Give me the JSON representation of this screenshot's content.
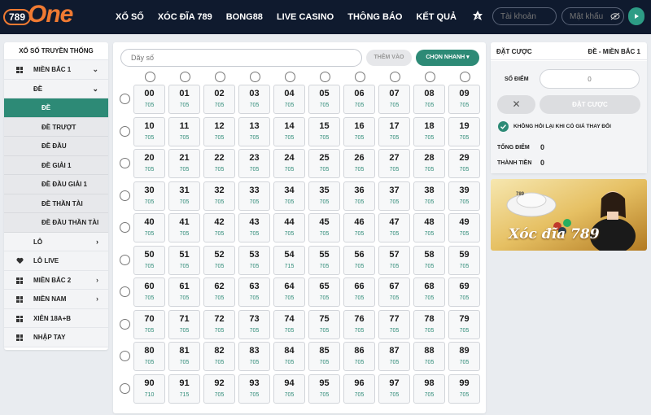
{
  "header": {
    "logo_prefix": "789",
    "logo_word": "One",
    "nav": [
      "XỔ SỐ",
      "XÓC ĐĨA 789",
      "BONG88",
      "LIVE CASINO",
      "THÔNG BÁO",
      "KẾT QUẢ"
    ],
    "account_placeholder": "Tài khoản",
    "password_placeholder": "Mật khẩu"
  },
  "sidebar": {
    "title": "XỔ SỐ TRUYỀN THỐNG",
    "mien_bac_1": "MIỀN BẮC 1",
    "de": "ĐỀ",
    "de_items": [
      "ĐỀ",
      "ĐỀ TRƯỢT",
      "ĐỀ ĐẦU",
      "ĐỀ GIẢI 1",
      "ĐỀ ĐẦU GIẢI 1",
      "ĐỀ THẦN TÀI",
      "ĐỀ ĐẦU THẦN TÀI"
    ],
    "lo": "LÔ",
    "lo_live": "LÔ LIVE",
    "mien_bac_2": "MIỀN BẮC 2",
    "mien_nam": "MIỀN NAM",
    "xien": "XIÊN 18A+B",
    "nhap_tay": "NHẬP TAY"
  },
  "main": {
    "input_placeholder": "Dãy số",
    "add_label": "THÊM VÀO",
    "quick_label": "CHỌN NHANH",
    "rates": [
      [
        "705",
        "705",
        "705",
        "705",
        "705",
        "705",
        "705",
        "705",
        "705",
        "705"
      ],
      [
        "705",
        "705",
        "705",
        "705",
        "705",
        "705",
        "705",
        "705",
        "705",
        "705"
      ],
      [
        "705",
        "705",
        "705",
        "705",
        "705",
        "705",
        "705",
        "705",
        "705",
        "705"
      ],
      [
        "705",
        "705",
        "705",
        "705",
        "705",
        "705",
        "705",
        "705",
        "705",
        "705"
      ],
      [
        "705",
        "705",
        "705",
        "705",
        "705",
        "705",
        "705",
        "705",
        "705",
        "705"
      ],
      [
        "705",
        "705",
        "705",
        "705",
        "715",
        "705",
        "705",
        "705",
        "705",
        "705"
      ],
      [
        "705",
        "705",
        "705",
        "705",
        "705",
        "705",
        "705",
        "705",
        "705",
        "705"
      ],
      [
        "705",
        "705",
        "705",
        "705",
        "705",
        "705",
        "705",
        "705",
        "705",
        "705"
      ],
      [
        "705",
        "705",
        "705",
        "705",
        "705",
        "705",
        "705",
        "705",
        "705",
        "705"
      ],
      [
        "710",
        "715",
        "705",
        "705",
        "705",
        "705",
        "705",
        "705",
        "705",
        "705"
      ]
    ]
  },
  "bet": {
    "title": "ĐẶT CƯỢC",
    "region": "ĐỀ - MIỀN BẮC 1",
    "points_label": "SỐ ĐIỂM",
    "points_placeholder": "0",
    "clear_symbol": "✕",
    "place_label": "ĐẶT CƯỢC",
    "no_ask_label": "KHÔNG HỎI LẠI KHI CÓ GIÁ THAY ĐỔI",
    "total_points_label": "TỔNG ĐIỂM",
    "total_points_value": "0",
    "total_money_label": "THÀNH TIỀN",
    "total_money_value": "0"
  },
  "banner": {
    "text": "Xóc đĩa 789",
    "badge": "789"
  },
  "colors": {
    "accent": "#2d8a76",
    "header": "#0f1a2e",
    "logo": "#f07a32"
  }
}
